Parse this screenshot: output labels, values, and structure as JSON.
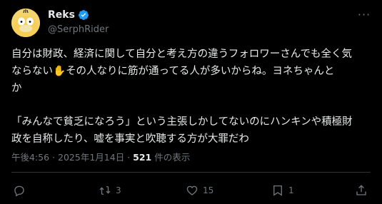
{
  "author": {
    "name": "Reks",
    "handle": "@SerphRider"
  },
  "post": {
    "line1": "自分は財政、経済に関して自分と考え方の違うフォロワーさんでも全く気",
    "line2a": "ならない",
    "hand_emoji": "✋",
    "line2b": "その人なりに筋が通ってる人が多いからね。ヨネちゃんと",
    "line3": "か",
    "line4": "「みんなで貧乏になろう」という主張しかしてないのにハンキンや積極財",
    "line5": "政を自称したり、嘘を事実と吹聴する方が大罪だわ"
  },
  "meta": {
    "time": "午後4:56",
    "separator": "·",
    "date": "2025年1月14日",
    "views_count": "521",
    "views_label": "件の表示"
  },
  "actions": {
    "reply_count": "",
    "repost_count": "3",
    "like_count": "15",
    "bookmark_count": "1"
  },
  "colors": {
    "background": "#000000",
    "text": "#e7e9ea",
    "muted": "#71767b",
    "verified": "#1d9bf0"
  }
}
